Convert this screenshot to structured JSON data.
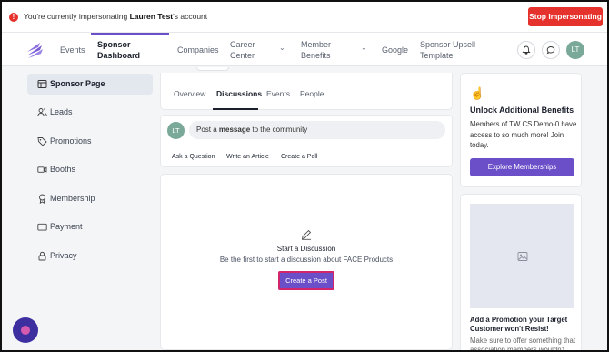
{
  "banner": {
    "message_prefix": "You're currently impersonating ",
    "user_name": "Lauren Test",
    "message_suffix": "'s account",
    "stop_label": "Stop Impersonating"
  },
  "nav": {
    "items": [
      {
        "label": "Events"
      },
      {
        "label": "Sponsor Dashboard"
      },
      {
        "label": "Companies"
      },
      {
        "label": "Career Center"
      },
      {
        "label": "Member Benefits"
      },
      {
        "label": "Google"
      },
      {
        "label": "Sponsor Upsell Template"
      }
    ],
    "avatar_initials": "LT"
  },
  "sidebar": {
    "items": [
      {
        "label": "Sponsor Page",
        "icon": "layout-icon"
      },
      {
        "label": "Leads",
        "icon": "users-icon"
      },
      {
        "label": "Promotions",
        "icon": "tag-icon"
      },
      {
        "label": "Booths",
        "icon": "video-icon"
      },
      {
        "label": "Membership",
        "icon": "award-icon"
      },
      {
        "label": "Payment",
        "icon": "credit-card-icon"
      },
      {
        "label": "Privacy",
        "icon": "lock-icon"
      }
    ]
  },
  "tabs": [
    {
      "label": "Overview"
    },
    {
      "label": "Discussions"
    },
    {
      "label": "Events"
    },
    {
      "label": "People"
    }
  ],
  "composer": {
    "avatar_initials": "LT",
    "placeholder_prefix": "Post a ",
    "placeholder_bold": "message",
    "placeholder_suffix": " to the community",
    "actions": [
      "Ask a Question",
      "Write an Article",
      "Create a Poll"
    ]
  },
  "empty_state": {
    "title": "Start a Discussion",
    "subtitle": "Be the first to start a discussion about FACE Products",
    "button": "Create a Post"
  },
  "benefits_card": {
    "icon": "pointing-hand-icon",
    "title": "Unlock Additional Benefits",
    "text": "Members of TW CS Demo-0 have access to so much more! Join today.",
    "button": "Explore Memberships"
  },
  "promo_card": {
    "title": "Add a Promotion your Target Customer won't Resist!",
    "text": "Make sure to offer something that association members wouldn't"
  },
  "colors": {
    "accent": "#6b4fc9",
    "danger": "#e5322d",
    "avatar": "#7aa99a"
  }
}
